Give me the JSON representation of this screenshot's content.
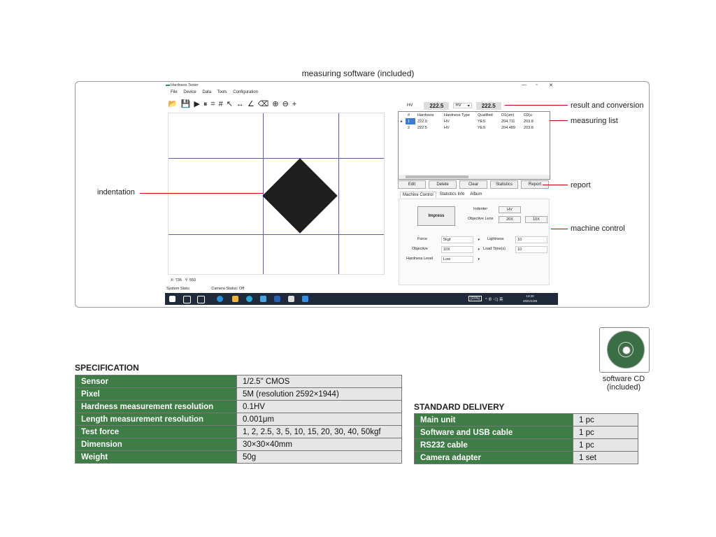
{
  "caption_top": "measuring software (included)",
  "app": {
    "title": "Hardness Tester",
    "window_controls": [
      "—",
      "▫",
      "✕"
    ],
    "menu": [
      "File",
      "Device",
      "Data",
      "Tools",
      "Configuration"
    ],
    "toolbar_icons": [
      "open-folder-icon",
      "save-icon",
      "play-icon",
      "pause-icon",
      "grid-icon",
      "crosshair-grid-icon",
      "select-icon",
      "measure-length-icon",
      "angle-icon",
      "eraser-icon",
      "zoom-in-icon",
      "zoom-out-icon",
      "plus-icon"
    ],
    "toolbar_glyphs": [
      "📂",
      "💾",
      "▶",
      "⏸",
      "⌗",
      "#",
      "↖",
      "↔",
      "∠",
      "⌫",
      "⊕",
      "⊖",
      "+"
    ],
    "coords": {
      "x_label": "X:",
      "x_value": "736",
      "y_label": "Y:",
      "y_value": "550"
    },
    "status": {
      "system": "System Statu",
      "camera": "Camera Status: Off"
    },
    "hv": {
      "label": "HV",
      "value": "222.5",
      "unit_select": "HV",
      "converted": "222.5"
    },
    "list": {
      "headers": [
        "",
        "#",
        "Hardness",
        "Hardness Type",
        "Qualified",
        "D1(um)",
        "D2(u"
      ],
      "rows": [
        [
          "▸",
          "1",
          "222.0",
          "HV",
          "YES",
          "204.711",
          "203.8"
        ],
        [
          "",
          "2",
          "222.5",
          "HV",
          "YES",
          "204.489",
          "203.8"
        ]
      ]
    },
    "buttons": [
      "Edit",
      "Delete",
      "Clear",
      "Statistics",
      "Report"
    ],
    "tabs": [
      "Machine Control",
      "Statistics Info",
      "Album"
    ],
    "machine": {
      "impress": "Impress",
      "indenter_label": "Indenter",
      "indenter_value": "HV",
      "objective_lens_label": "Objective Lens",
      "lens_options": [
        "20X",
        "10X"
      ],
      "force_label": "Force",
      "force_value": "5kgf",
      "objective_label": "Objective",
      "objective_value": "10X",
      "hardness_level_label": "Hardness Level",
      "hardness_level_value": "Low",
      "lightness_label": "Lightness",
      "lightness_value": "10",
      "load_time_label": "Load Time(s)",
      "load_time_value": "10"
    },
    "taskbar": {
      "battery": "[15%]",
      "tray": "^ ⊕ ◁) 英",
      "time": "14:20",
      "date": "2021/1/28"
    }
  },
  "callouts": {
    "indentation": "indentation",
    "result": "result and conversion",
    "list": "measuring list",
    "report": "report",
    "machine": "machine control"
  },
  "specification": {
    "title": "SPECIFICATION",
    "rows": [
      [
        "Sensor",
        "1/2.5\" CMOS"
      ],
      [
        "Pixel",
        "5M (resolution 2592×1944)"
      ],
      [
        "Hardness measurement resolution",
        "0.1HV"
      ],
      [
        "Length measurement resolution",
        "0.001μm"
      ],
      [
        "Test force",
        "1, 2, 2.5, 3, 5, 10, 15, 20, 30, 40, 50kgf"
      ],
      [
        "Dimension",
        "30×30×40mm"
      ],
      [
        "Weight",
        "50g"
      ]
    ]
  },
  "delivery": {
    "title": "STANDARD DELIVERY",
    "rows": [
      [
        "Main unit",
        "1 pc"
      ],
      [
        "Software and USB cable",
        "1 pc"
      ],
      [
        "RS232 cable",
        "1 pc"
      ],
      [
        "Camera adapter",
        "1 set"
      ]
    ]
  },
  "cd": {
    "label_line1": "software CD",
    "label_line2": "(included)"
  }
}
